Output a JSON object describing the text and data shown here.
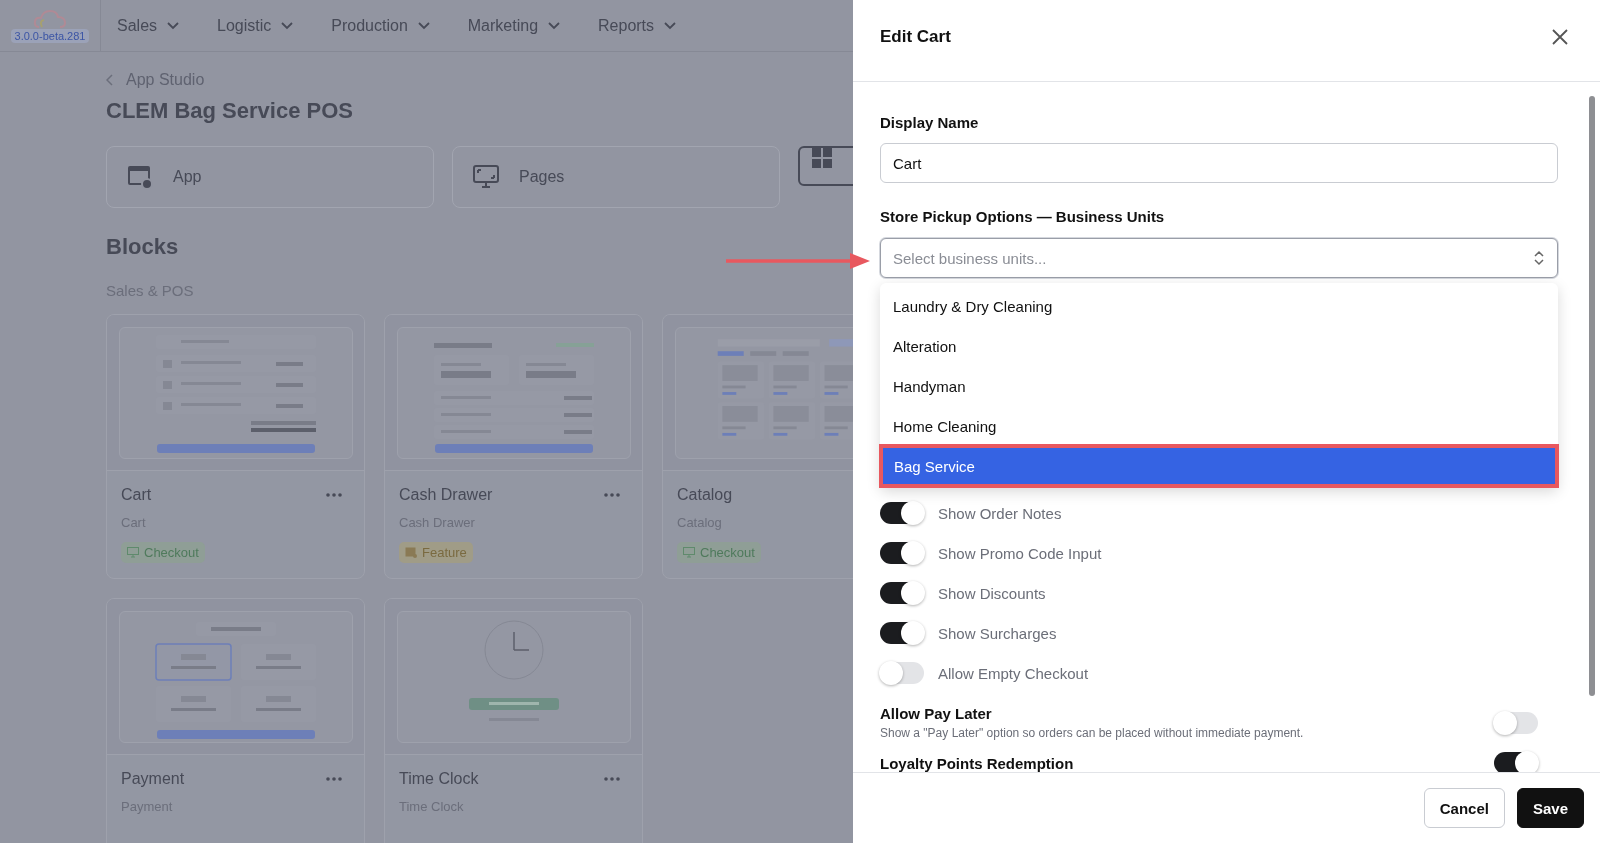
{
  "nav": {
    "version": "3.0.0-beta.281",
    "menus": [
      "Sales",
      "Logistic",
      "Production",
      "Marketing",
      "Reports"
    ]
  },
  "page": {
    "back_link": "App Studio",
    "title": "CLEM Bag Service POS",
    "sections": [
      {
        "label": "App",
        "kind": "app",
        "selected": false
      },
      {
        "label": "Pages",
        "kind": "pages",
        "selected": false
      },
      {
        "kind": "grid",
        "selected": true
      }
    ],
    "blocks_heading": "Blocks",
    "group_label": "Sales & POS",
    "blocks": [
      {
        "name": "Cart",
        "subtitle": "Cart",
        "kind": "cart",
        "tag": {
          "label": "Checkout",
          "kind": "checkout"
        }
      },
      {
        "name": "Cash Drawer",
        "subtitle": "Cash Drawer",
        "kind": "cash_drawer",
        "tag": {
          "label": "Feature",
          "kind": "feature"
        }
      },
      {
        "name": "Catalog",
        "subtitle": "Catalog",
        "kind": "catalog",
        "tag": {
          "label": "Checkout",
          "kind": "checkout"
        }
      },
      {
        "name": "Payment",
        "subtitle": "Payment",
        "kind": "payment"
      },
      {
        "name": "Time Clock",
        "subtitle": "Time Clock",
        "kind": "time_clock"
      }
    ]
  },
  "drawer": {
    "title": "Edit Cart",
    "display_name": {
      "label": "Display Name",
      "value": "Cart"
    },
    "pickup": {
      "label": "Store Pickup Options — Business Units",
      "placeholder": "Select business units...",
      "expanded": true,
      "options": [
        {
          "label": "Laundry & Dry Cleaning",
          "selected": false
        },
        {
          "label": "Alteration",
          "selected": false
        },
        {
          "label": "Handyman",
          "selected": false
        },
        {
          "label": "Home Cleaning",
          "selected": false
        },
        {
          "label": "Bag Service",
          "selected": true
        }
      ]
    },
    "toggles": [
      {
        "label": "Show Order Notes",
        "on": true
      },
      {
        "label": "Show Promo Code Input",
        "on": true
      },
      {
        "label": "Show Discounts",
        "on": true
      },
      {
        "label": "Show Surcharges",
        "on": true
      },
      {
        "label": "Allow Empty Checkout",
        "on": false
      }
    ],
    "settings": [
      {
        "title": "Allow Pay Later",
        "description": "Show a \"Pay Later\" option so orders can be placed without immediate payment.",
        "on": false
      },
      {
        "title": "Loyalty Points Redemption",
        "on": true
      }
    ],
    "buttons": [
      {
        "label": "Cancel",
        "kind": "secondary"
      },
      {
        "label": "Save",
        "kind": "primary"
      }
    ]
  },
  "annotation_arrow": true
}
